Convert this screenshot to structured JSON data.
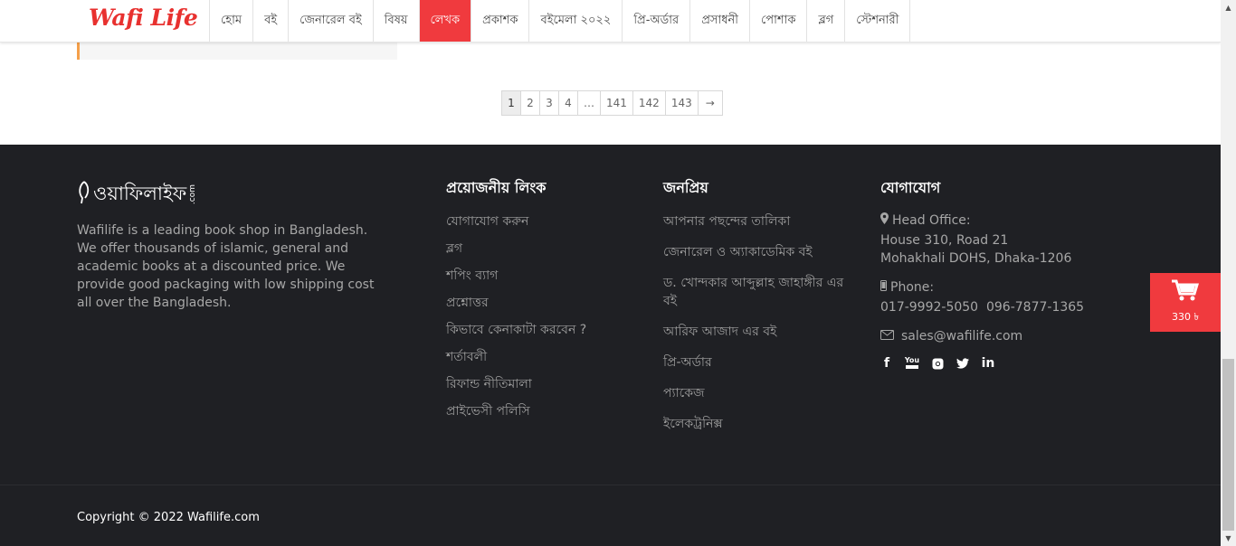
{
  "header": {
    "logo": "Wafi Life",
    "nav": [
      {
        "label": "হোম",
        "active": false
      },
      {
        "label": "বই",
        "active": false
      },
      {
        "label": "জেনারেল বই",
        "active": false
      },
      {
        "label": "বিষয়",
        "active": false
      },
      {
        "label": "লেখক",
        "active": true
      },
      {
        "label": "প্রকাশক",
        "active": false
      },
      {
        "label": "বইমেলা ২০২২",
        "active": false
      },
      {
        "label": "প্রি-অর্ডার",
        "active": false
      },
      {
        "label": "প্রসাধনী",
        "active": false
      },
      {
        "label": "পোশাক",
        "active": false
      },
      {
        "label": "ব্লগ",
        "active": false
      },
      {
        "label": "স্টেশনারী",
        "active": false
      }
    ]
  },
  "pagination": {
    "pages": [
      "1",
      "2",
      "3",
      "4",
      "…",
      "141",
      "142",
      "143"
    ],
    "current": "1",
    "next": "→"
  },
  "footer": {
    "brand_text": "ওয়াফিলাইফ",
    "brand_suffix": ".com",
    "description": "Wafilife is a leading book shop in Bangladesh. We offer thousands of islamic, general and academic books at a discounted price. We provide good packaging with low shipping cost all over the Bangladesh.",
    "links": {
      "title": "প্রয়োজনীয় লিংক",
      "items": [
        "যোগাযোগ করুন",
        "ব্লগ",
        "শপিং ব্যাগ",
        "প্রশ্নোত্তর",
        "কিভাবে কেনাকাটা করবেন ?",
        "শর্তাবলী",
        "রিফান্ড নীতিমালা",
        "প্রাইভেসী পলিসি"
      ]
    },
    "popular": {
      "title": "জনপ্রিয়",
      "items": [
        "আপনার পছন্দের তালিকা",
        "জেনারেল ও অ্যাকাডেমিক বই",
        "ড. খোন্দকার আব্দুল্লাহ জাহাঙ্গীর এর বই",
        "আরিফ আজাদ এর বই",
        "প্রি-অর্ডার",
        "প্যাকেজ",
        "ইলেকট্রনিক্স"
      ]
    },
    "contact": {
      "title": "যোগাযোগ",
      "head_office_label": "Head Office:",
      "address_line1": "House 310, Road 21",
      "address_line2": "Mohakhali DOHS, Dhaka-1206",
      "phone_label": "Phone:",
      "phones": "017-9992-5050  096-7877-1365",
      "email": "sales@wafilife.com",
      "social": [
        "facebook",
        "youtube",
        "instagram",
        "twitter",
        "linkedin"
      ]
    },
    "copyright": "Copyright © 2022 Wafilife.com"
  },
  "cart": {
    "amount": "330 ৳"
  },
  "colors": {
    "accent": "#f03a3e",
    "footer_bg": "#1f2024",
    "card_border": "#f5a04a"
  }
}
